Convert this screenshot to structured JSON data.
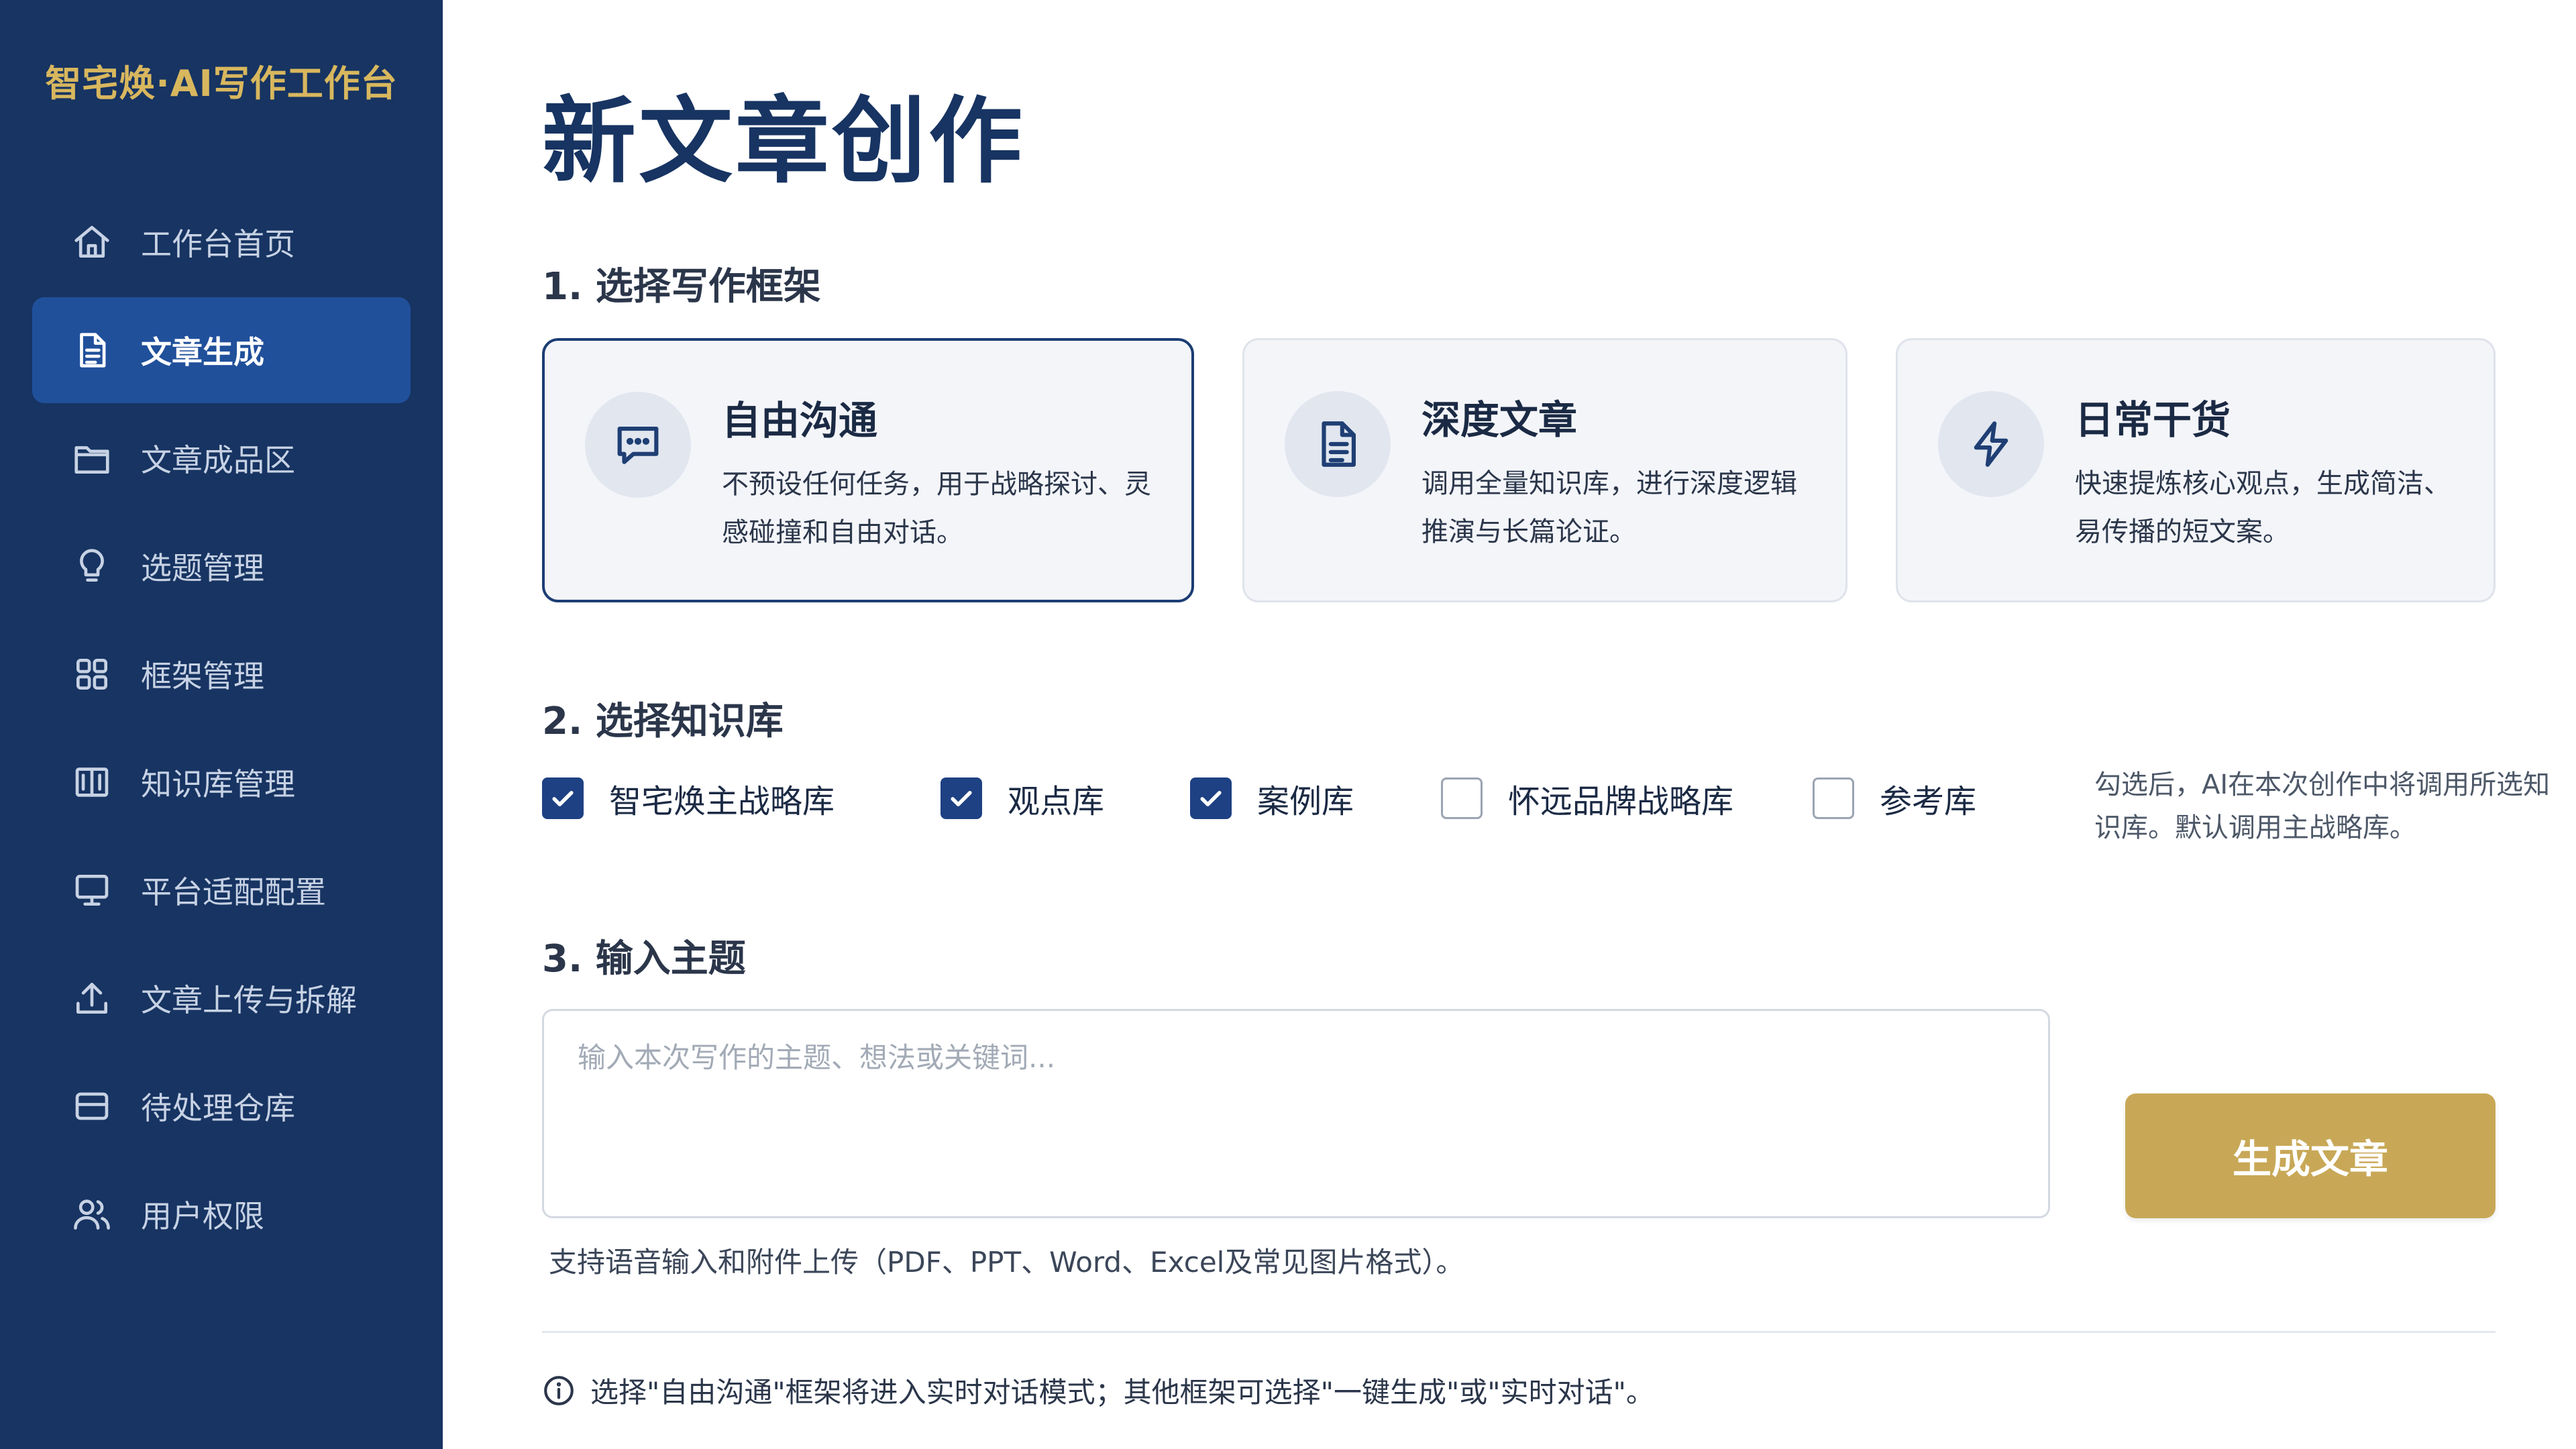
{
  "app": {
    "brand": "智宅焕·AI写作工作台"
  },
  "sidebar": {
    "items": [
      {
        "label": "工作台首页",
        "icon": "home-icon",
        "active": false
      },
      {
        "label": "文章生成",
        "icon": "document-icon",
        "active": true
      },
      {
        "label": "文章成品区",
        "icon": "folder-icon",
        "active": false
      },
      {
        "label": "选题管理",
        "icon": "lightbulb-icon",
        "active": false
      },
      {
        "label": "框架管理",
        "icon": "grid-icon",
        "active": false
      },
      {
        "label": "知识库管理",
        "icon": "book-icon",
        "active": false
      },
      {
        "label": "平台适配配置",
        "icon": "monitor-icon",
        "active": false
      },
      {
        "label": "文章上传与拆解",
        "icon": "upload-icon",
        "active": false
      },
      {
        "label": "待处理仓库",
        "icon": "inbox-icon",
        "active": false
      },
      {
        "label": "用户权限",
        "icon": "users-icon",
        "active": false
      }
    ]
  },
  "main": {
    "title": "新文章创作",
    "step1": {
      "heading": "1. 选择写作框架",
      "cards": [
        {
          "title": "自由沟通",
          "desc": "不预设任何任务，用于战略探讨、灵感碰撞和自由对话。",
          "icon": "chat-icon",
          "selected": true
        },
        {
          "title": "深度文章",
          "desc": "调用全量知识库，进行深度逻辑推演与长篇论证。",
          "icon": "document-icon",
          "selected": false
        },
        {
          "title": "日常干货",
          "desc": "快速提炼核心观点，生成简洁、易传播的短文案。",
          "icon": "lightning-icon",
          "selected": false
        }
      ]
    },
    "step2": {
      "heading": "2. 选择知识库",
      "options": [
        {
          "label": "智宅焕主战略库",
          "checked": true
        },
        {
          "label": "观点库",
          "checked": true
        },
        {
          "label": "案例库",
          "checked": true
        },
        {
          "label": "怀远品牌战略库",
          "checked": false
        },
        {
          "label": "参考库",
          "checked": false
        }
      ],
      "note": "勾选后，AI在本次创作中将调用所选知识库。默认调用主战略库。"
    },
    "step3": {
      "heading": "3. 输入主题",
      "placeholder": "输入本次写作的主题、想法或关键词...",
      "value": "",
      "generate_label": "生成文章",
      "hint": "支持语音输入和附件上传（PDF、PPT、Word、Excel及常见图片格式）。"
    },
    "footer_note": "选择\"自由沟通\"框架将进入实时对话模式；其他框架可选择\"一键生成\"或\"实时对话\"。"
  },
  "colors": {
    "sidebar_bg": "#173462",
    "sidebar_active": "#21509b",
    "brand_gold": "#d8b75e",
    "button_gold": "#c8a857",
    "checkbox_blue": "#1e4183",
    "title_navy": "#173462"
  }
}
